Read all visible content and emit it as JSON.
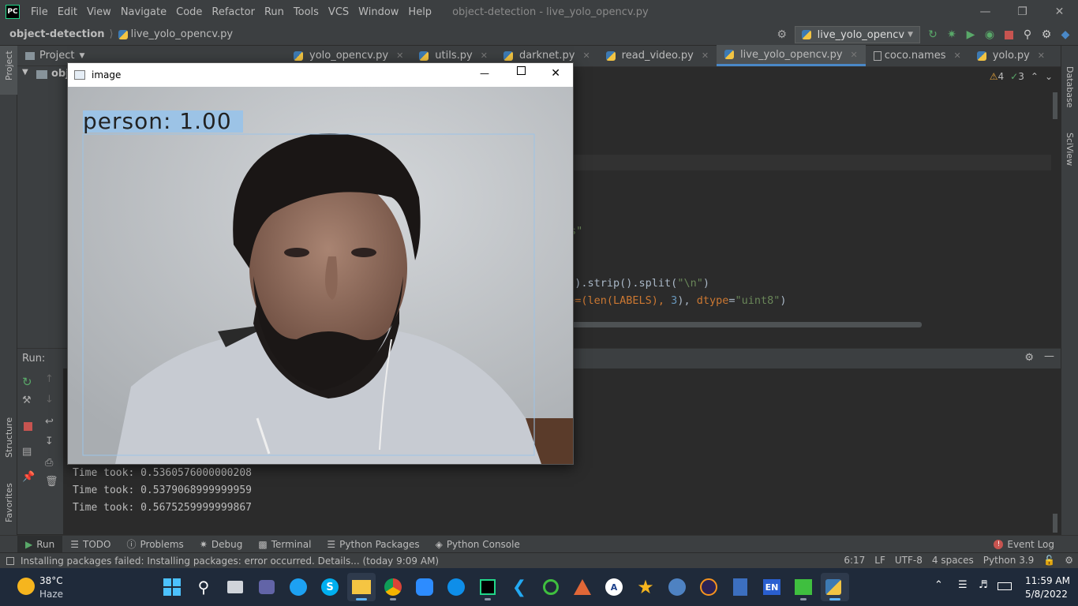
{
  "menubar": {
    "app_logo": "PC",
    "items": [
      "File",
      "Edit",
      "View",
      "Navigate",
      "Code",
      "Refactor",
      "Run",
      "Tools",
      "VCS",
      "Window",
      "Help"
    ],
    "window_title": "object-detection - live_yolo_opencv.py"
  },
  "navbar": {
    "project": "object-detection",
    "file": "live_yolo_opencv.py",
    "run_config": "live_yolo_opencv"
  },
  "project_panel": {
    "title": "Project",
    "root_label": "obje"
  },
  "tabs": [
    {
      "label": "yolo_opencv.py",
      "active": false
    },
    {
      "label": "utils.py",
      "active": false
    },
    {
      "label": "darknet.py",
      "active": false
    },
    {
      "label": "read_video.py",
      "active": false
    },
    {
      "label": "live_yolo_opencv.py",
      "active": true
    },
    {
      "label": "coco.names",
      "active": false
    },
    {
      "label": "yolo.py",
      "active": false
    }
  ],
  "editor": {
    "warnings": "4",
    "checks": "3",
    "line_str": "s\"",
    "line_split_a": "d().strip().split(",
    "line_split_str": "\"\\n\"",
    "line_split_b": ")",
    "line_size_a": "ze=(len(LABELS), ",
    "line_size_num": "3",
    "line_size_b": "), ",
    "line_size_kw": "dtype",
    "line_size_c": "=",
    "line_size_str": "\"uint8\"",
    "line_size_d": ")"
  },
  "run_panel": {
    "label": "Run:",
    "console_lines": [
      "Time took: 0.5360576000000208",
      "Time took: 0.5379068999999959",
      "Time took: 0.5675259999999867"
    ]
  },
  "image_window": {
    "title": "image",
    "detection_label": "person: 1.00"
  },
  "left_strip": {
    "project": "Project",
    "structure": "Structure",
    "favorites": "Favorites"
  },
  "right_strip": {
    "database": "Database",
    "sciview": "SciView"
  },
  "tool_tabs": [
    "Run",
    "TODO",
    "Problems",
    "Debug",
    "Terminal",
    "Python Packages",
    "Python Console"
  ],
  "event_log": "Event Log",
  "statusbar": {
    "message": "Installing packages failed: Installing packages: error occurred. Details... (today 9:09 AM)",
    "position": "6:17",
    "line_sep": "LF",
    "encoding": "UTF-8",
    "indent": "4 spaces",
    "interpreter": "Python 3.9"
  },
  "taskbar": {
    "temp": "38°C",
    "weather": "Haze",
    "lang": "EN",
    "time": "11:59 AM",
    "date": "5/8/2022"
  },
  "colors": {
    "accent": "#4a88c7",
    "bg": "#2b2b2b",
    "panel": "#3c3f41",
    "bbox": "#9cc3e6"
  }
}
